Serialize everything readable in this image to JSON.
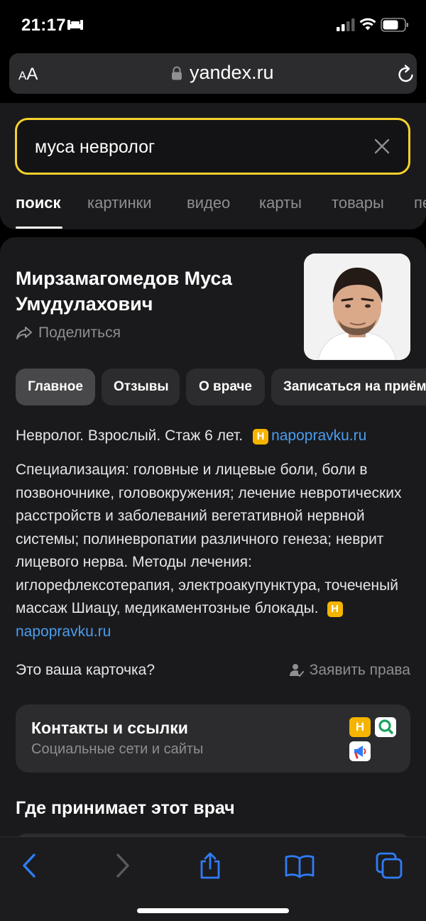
{
  "status_bar": {
    "time": "21:17",
    "icons": [
      "bed-icon",
      "cellular-signal-icon",
      "wifi-icon",
      "battery-icon"
    ]
  },
  "browser": {
    "text_size_label_small": "A",
    "text_size_label_large": "A",
    "url": "yandex.ru",
    "icons": [
      "lock-icon",
      "reload-icon"
    ]
  },
  "search": {
    "query": "муса невролог",
    "tabs": [
      {
        "label": "поиск",
        "active": true
      },
      {
        "label": "картинки"
      },
      {
        "label": "видео"
      },
      {
        "label": "карты"
      },
      {
        "label": "товары"
      },
      {
        "label": "пе"
      }
    ]
  },
  "card": {
    "name": "Мирзамагомедов Муса Умудулахович",
    "share_label": "Поделиться",
    "pills": [
      "Главное",
      "Отзывы",
      "О враче",
      "Записаться на приём"
    ],
    "summary": "Невролог. Взрослый. Стаж 6 лет.",
    "source_badge": "Н",
    "source_link": "napopravku.ru",
    "description": "Специализация: головные и лицевые боли, боли в позвоночнике, головокружения; лечение невротических расстройств и заболеваний вегетативной нервной системы; полиневропатии различного генеза; неврит лицевого нерва. Методы лечения: иглорефлексотерапия, электроакупунктура, точеченый массаж Шиацу, медикаментозные блокады.",
    "claim_question": "Это ваша карточка?",
    "claim_label": "Заявить права",
    "contacts_title": "Контакты и ссылки",
    "contacts_subtitle": "Социальные сети и сайты",
    "contacts_badge": "Н",
    "where_title": "Где принимает этот врач"
  },
  "colors": {
    "accent_yellow": "#f5d12e",
    "link_blue": "#4a9df0",
    "toolbar_blue": "#2f7cf6",
    "badge_orange": "#f4b400"
  },
  "toolbar": {
    "icons": [
      "back-icon",
      "forward-icon",
      "share-icon",
      "bookmarks-icon",
      "tabs-icon"
    ]
  }
}
